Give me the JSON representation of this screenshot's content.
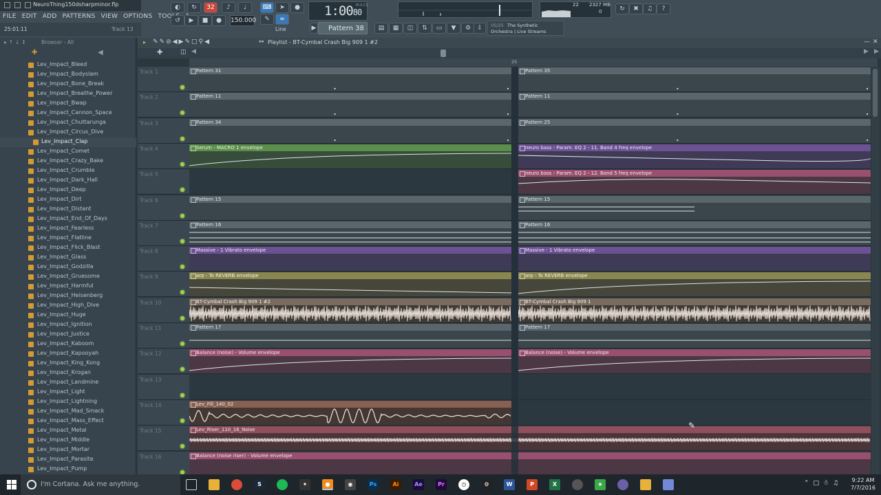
{
  "window": {
    "project_title": "NeuroThing150dsharpminor.flp",
    "menu": [
      "FILE",
      "EDIT",
      "ADD",
      "PATTERNS",
      "VIEW",
      "OPTIONS",
      "TOOLS",
      "?"
    ],
    "hint_left": "25:01:11",
    "hint_right": "Track 13"
  },
  "transport": {
    "tempo": "150.000",
    "time": "1:00",
    "time_frac": "80",
    "time_unit": "M:S:CS",
    "line_mode": "Line",
    "pattern": "Pattern 38"
  },
  "monitor": {
    "poly": "22",
    "memory": "2327 MB",
    "poly2": "0"
  },
  "news": {
    "count": "05/25",
    "title": "The Synthetic",
    "subtitle": "Orchestra | Live Streams"
  },
  "browser": {
    "label": "Browser - All",
    "items": [
      "Lev_Impact_Bleed",
      "Lev_Impact_Bodyslam",
      "Lev_Impact_Bone_Break",
      "Lev_Impact_Breathe_Power",
      "Lev_Impact_Bwap",
      "Lev_Impact_Cannon_Space",
      "Lev_Impact_Chuttarunga",
      "Lev_Impact_Circus_Dive",
      "Lev_Impact_Clap",
      "Lev_Impact_Comet",
      "Lev_Impact_Crazy_Bake",
      "Lev_Impact_Crumble",
      "Lev_Impact_Dark_Hall",
      "Lev_Impact_Deep",
      "Lev_Impact_Dirt",
      "Lev_Impact_Distant",
      "Lev_Impact_End_Of_Days",
      "Lev_Impact_Fearless",
      "Lev_Impact_Flatline",
      "Lev_Impact_Flick_Blast",
      "Lev_Impact_Glass",
      "Lev_Impact_Godzilla",
      "Lev_Impact_Gruesome",
      "Lev_Impact_Harmful",
      "Lev_Impact_Heisenberg",
      "Lev_Impact_High_Dive",
      "Lev_Impact_Huge",
      "Lev_Impact_Ignition",
      "Lev_Impact_Justice",
      "Lev_Impact_Kaboom",
      "Lev_Impact_Kapooyah",
      "Lev_Impact_King_Kong",
      "Lev_Impact_Krogan",
      "Lev_Impact_Landmine",
      "Lev_Impact_Light",
      "Lev_Impact_Lightning",
      "Lev_Impact_Mad_Smack",
      "Lev_Impact_Mass_Effect",
      "Lev_Impact_Metal",
      "Lev_Impact_Middle",
      "Lev_Impact_Mortar",
      "Lev_Impact_Parasite",
      "Lev_Impact_Pump"
    ],
    "selected": "Lev_Impact_Clap"
  },
  "playlist": {
    "title": "Playlist - BT-Cymbal Crash Big 909 1 #2",
    "ruler_mark": "25",
    "tracks": [
      "Track 1",
      "Track 2",
      "Track 3",
      "Track 4",
      "Track 5",
      "Track 6",
      "Track 7",
      "Track 8",
      "Track 9",
      "Track 10",
      "Track 11",
      "Track 12",
      "Track 13",
      "Track 14",
      "Track 15",
      "Track 16"
    ],
    "clips": {
      "t1a": "Pattern 31",
      "t1b": "Pattern 35",
      "t2a": "Pattern 11",
      "t2b": "Pattern 11",
      "t3a": "Pattern 34",
      "t3b": "Pattern 25",
      "t4a": "Serum - MACRO 1 envelope",
      "t4b": "neuro bass - Param. EQ 2 - 11. Band 4 freq envelope",
      "t5b": "neuro bass - Param. EQ 2 - 12. Band 5 freq envelope",
      "t6a": "Pattern 15",
      "t6b": "Pattern 15",
      "t7a": "Pattern 16",
      "t7b": "Pattern 16",
      "t8a": "Massive - 1 Vibrato envelope",
      "t8b": "Massive - 1 Vibrato envelope",
      "t9a": "arp - To REVERB envelope",
      "t9b": "arp - To REVERB envelope",
      "t10a": "BT-Cymbal Crash Big 909 1 #2",
      "t10b": "BT-Cymbal Crash Big 909 1",
      "t11a": "Pattern 17",
      "t11b": "Pattern 17",
      "t12a": "Balance (noise) - Volume envelope",
      "t12b": "Balance (noise) - Volume envelope",
      "t14a": "Lev_Fill_140_02",
      "t15a": "Lev_Riser_110_16_Noise",
      "t16a": "Balance (noise riser) - Volume envelope"
    }
  },
  "taskbar": {
    "cortana": "I'm Cortana. Ask me anything.",
    "time": "9:22 AM",
    "date": "7/7/2016"
  }
}
